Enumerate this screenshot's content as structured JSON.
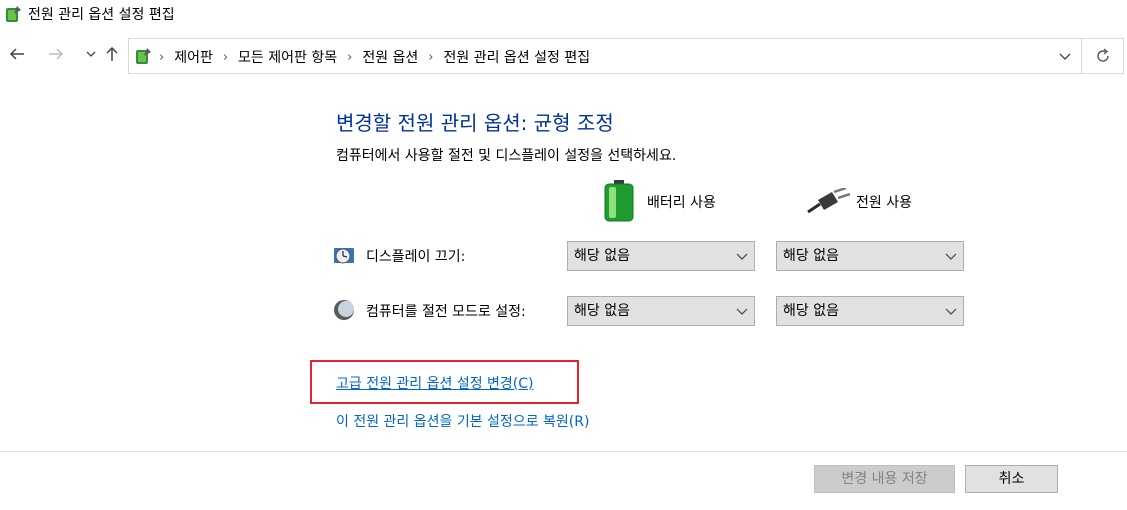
{
  "window": {
    "title": "전원 관리 옵션 설정 편집"
  },
  "nav": {
    "back_icon": "back-arrow-icon",
    "forward_icon": "forward-arrow-icon",
    "recent_icon": "chevron-down-icon",
    "up_icon": "up-arrow-icon",
    "breadcrumb": [
      "제어판",
      "모든 제어판 항목",
      "전원 옵션",
      "전원 관리 옵션 설정 편집"
    ],
    "refresh_icon": "refresh-icon"
  },
  "main": {
    "heading": "변경할 전원 관리 옵션: 균형 조정",
    "subtext": "컴퓨터에서 사용할 절전 및 디스플레이 설정을 선택하세요.",
    "columns": {
      "battery": "배터리 사용",
      "plugged": "전원 사용"
    },
    "rows": {
      "display": {
        "label": "디스플레이 끄기:",
        "battery_value": "해당 없음",
        "plugged_value": "해당 없음"
      },
      "sleep": {
        "label": "컴퓨터를 절전 모드로 설정:",
        "battery_value": "해당 없음",
        "plugged_value": "해당 없음"
      }
    },
    "advanced_link": "고급 전원 관리 옵션 설정 변경(C)",
    "restore_link": "이 전원 관리 옵션을 기본 설정으로 복원(R)"
  },
  "footer": {
    "save_label": "변경 내용 저장",
    "cancel_label": "취소"
  },
  "colors": {
    "heading": "#003399",
    "link": "#0066cc",
    "highlight_box": "#e0262b"
  }
}
